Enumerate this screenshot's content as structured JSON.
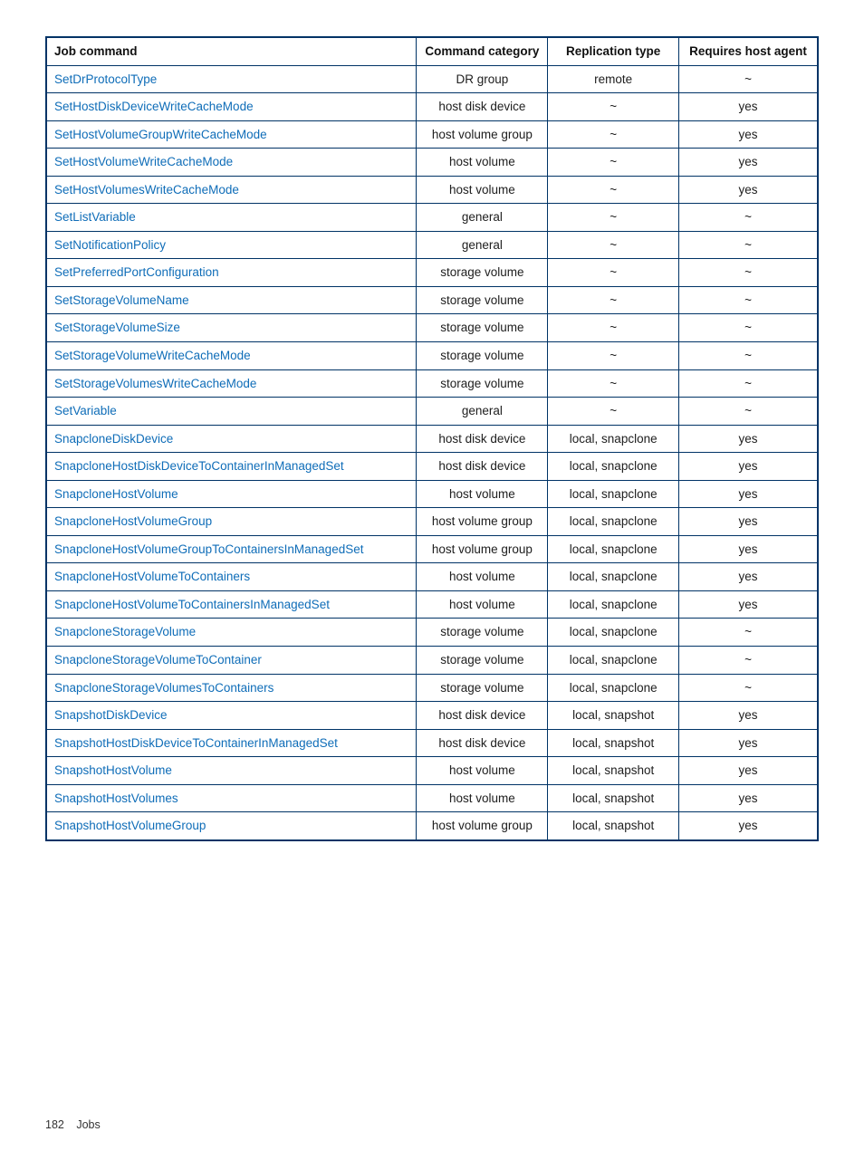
{
  "headers": {
    "job_command": "Job command",
    "command_category": "Command category",
    "replication_type": "Replication type",
    "requires_host_agent": "Requires host agent"
  },
  "rows": [
    {
      "cmd": "SetDrProtocolType",
      "cat": "DR group",
      "rep": "remote",
      "agent": "~"
    },
    {
      "cmd": "SetHostDiskDeviceWriteCacheMode",
      "cat": "host disk device",
      "rep": "~",
      "agent": "yes"
    },
    {
      "cmd": "SetHostVolumeGroupWriteCacheMode",
      "cat": "host volume group",
      "rep": "~",
      "agent": "yes"
    },
    {
      "cmd": "SetHostVolumeWriteCacheMode",
      "cat": "host volume",
      "rep": "~",
      "agent": "yes"
    },
    {
      "cmd": "SetHostVolumesWriteCacheMode",
      "cat": "host volume",
      "rep": "~",
      "agent": "yes"
    },
    {
      "cmd": "SetListVariable",
      "cat": "general",
      "rep": "~",
      "agent": "~"
    },
    {
      "cmd": "SetNotificationPolicy",
      "cat": "general",
      "rep": "~",
      "agent": "~"
    },
    {
      "cmd": "SetPreferredPortConfiguration",
      "cat": "storage volume",
      "rep": "~",
      "agent": "~"
    },
    {
      "cmd": "SetStorageVolumeName",
      "cat": "storage volume",
      "rep": "~",
      "agent": "~"
    },
    {
      "cmd": "SetStorageVolumeSize",
      "cat": "storage volume",
      "rep": "~",
      "agent": "~"
    },
    {
      "cmd": "SetStorageVolumeWriteCacheMode",
      "cat": "storage volume",
      "rep": "~",
      "agent": "~"
    },
    {
      "cmd": "SetStorageVolumesWriteCacheMode",
      "cat": "storage volume",
      "rep": "~",
      "agent": "~"
    },
    {
      "cmd": "SetVariable",
      "cat": "general",
      "rep": "~",
      "agent": "~"
    },
    {
      "cmd": "SnapcloneDiskDevice",
      "cat": "host disk device",
      "rep": "local, snapclone",
      "agent": "yes"
    },
    {
      "cmd": "SnapcloneHostDiskDeviceToContainerInManagedSet",
      "cat": "host disk device",
      "rep": "local, snapclone",
      "agent": "yes"
    },
    {
      "cmd": "SnapcloneHostVolume",
      "cat": "host volume",
      "rep": "local, snapclone",
      "agent": "yes"
    },
    {
      "cmd": "SnapcloneHostVolumeGroup",
      "cat": "host volume group",
      "rep": "local, snapclone",
      "agent": "yes"
    },
    {
      "cmd": "SnapcloneHostVolumeGroupToContainersInManagedSet",
      "cat": "host volume group",
      "rep": "local, snapclone",
      "agent": "yes"
    },
    {
      "cmd": "SnapcloneHostVolumeToContainers",
      "cat": "host volume",
      "rep": "local, snapclone",
      "agent": "yes"
    },
    {
      "cmd": "SnapcloneHostVolumeToContainersInManagedSet",
      "cat": "host volume",
      "rep": "local, snapclone",
      "agent": "yes"
    },
    {
      "cmd": "SnapcloneStorageVolume",
      "cat": "storage volume",
      "rep": "local, snapclone",
      "agent": "~"
    },
    {
      "cmd": "SnapcloneStorageVolumeToContainer",
      "cat": "storage volume",
      "rep": "local, snapclone",
      "agent": "~"
    },
    {
      "cmd": "SnapcloneStorageVolumesToContainers",
      "cat": "storage volume",
      "rep": "local, snapclone",
      "agent": "~"
    },
    {
      "cmd": "SnapshotDiskDevice",
      "cat": "host disk device",
      "rep": "local, snapshot",
      "agent": "yes"
    },
    {
      "cmd": "SnapshotHostDiskDeviceToContainerInManagedSet",
      "cat": "host disk device",
      "rep": "local, snapshot",
      "agent": "yes"
    },
    {
      "cmd": "SnapshotHostVolume",
      "cat": "host volume",
      "rep": "local, snapshot",
      "agent": "yes"
    },
    {
      "cmd": "SnapshotHostVolumes",
      "cat": "host volume",
      "rep": "local, snapshot",
      "agent": "yes"
    },
    {
      "cmd": "SnapshotHostVolumeGroup",
      "cat": "host volume group",
      "rep": "local, snapshot",
      "agent": "yes"
    }
  ],
  "footer": {
    "page_number": "182",
    "section": "Jobs"
  }
}
